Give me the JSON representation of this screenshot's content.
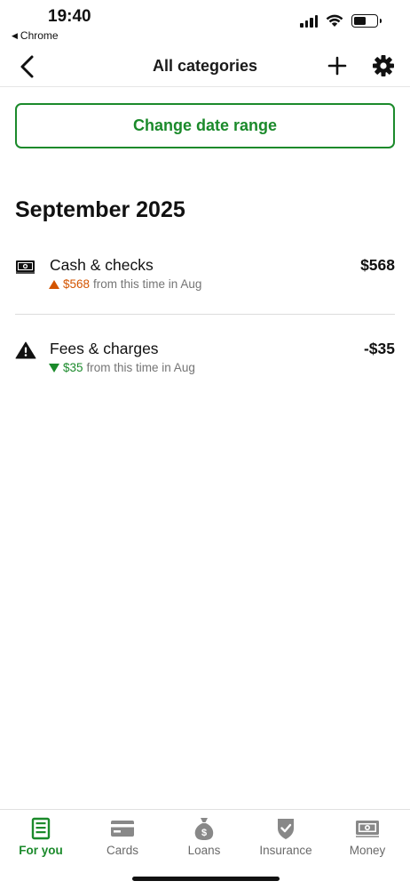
{
  "status_bar": {
    "time": "19:40",
    "back_app": "Chrome"
  },
  "nav": {
    "title": "All categories"
  },
  "date_button": {
    "label": "Change date range"
  },
  "month": {
    "title": "September 2025"
  },
  "categories": [
    {
      "name": "Cash & checks",
      "amount": "$568",
      "change_amount": "$568",
      "change_text": "from this time in Aug",
      "direction": "up",
      "icon": "cash-icon"
    },
    {
      "name": "Fees & charges",
      "amount": "-$35",
      "change_amount": "$35",
      "change_text": "from this time in Aug",
      "direction": "down",
      "icon": "warning-icon"
    }
  ],
  "tabs": [
    {
      "label": "For you",
      "icon": "for-you-icon",
      "active": true
    },
    {
      "label": "Cards",
      "icon": "card-icon",
      "active": false
    },
    {
      "label": "Loans",
      "icon": "money-bag-icon",
      "active": false
    },
    {
      "label": "Insurance",
      "icon": "shield-check-icon",
      "active": false
    },
    {
      "label": "Money",
      "icon": "cash-icon",
      "active": false
    }
  ],
  "colors": {
    "accent": "#1b8a2b",
    "increase": "#d35400",
    "decrease": "#1b8a2b",
    "inactive_tab": "#6a6a6a"
  }
}
